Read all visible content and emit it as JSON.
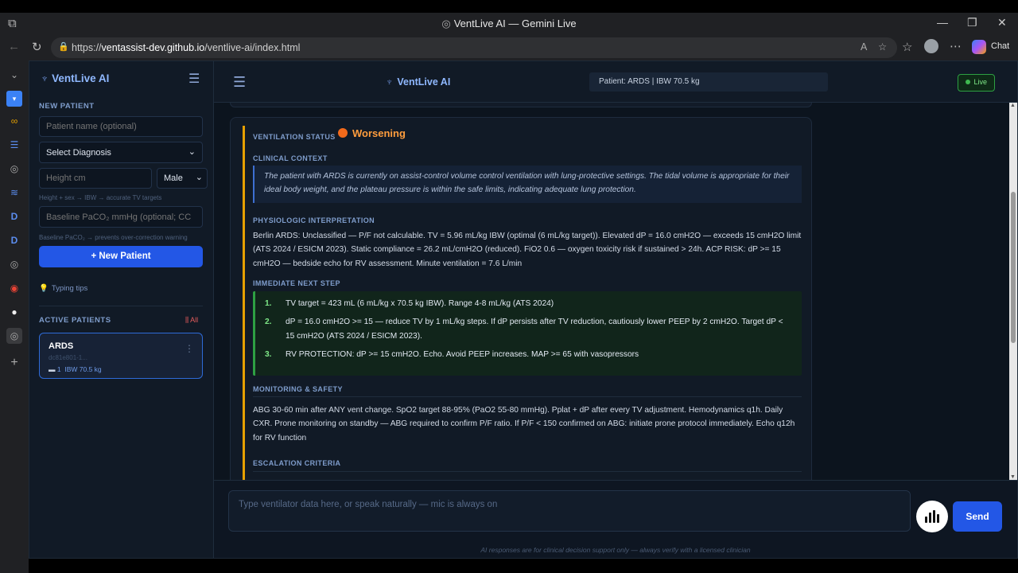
{
  "browser": {
    "window_title": "VentLive AI — Gemini Live",
    "url_prefix": "https://",
    "url_host": "ventassist-dev.github.io",
    "url_path": "/ventlive-ai/index.html",
    "chat_label": "Chat"
  },
  "sidebar": {
    "brand": "VentLive AI",
    "new_patient_label": "NEW PATIENT",
    "name_placeholder": "Patient name (optional)",
    "diagnosis_value": "Select Diagnosis",
    "height_placeholder": "Height cm",
    "sex_value": "Male",
    "height_hint": "Height + sex → IBW → accurate TV targets",
    "baseline_placeholder": "Baseline PaCO₂ mmHg (optional; CC",
    "baseline_hint": "Baseline PaCO₂ → prevents over-correction warning",
    "new_patient_button": "+ New Patient",
    "typing_tips": "Typing tips",
    "active_patients_label": "ACTIVE PATIENTS",
    "clear_all": "All",
    "patient": {
      "name": "ARDS",
      "id": "dc81e801-1...",
      "count": "1",
      "ibw": "IBW 70.5 kg"
    }
  },
  "header": {
    "brand": "VentLive AI",
    "patient_info": "Patient: ARDS | IBW 70.5 kg",
    "live": "Live"
  },
  "report": {
    "status_label": "VENTILATION STATUS",
    "status_value": "Worsening",
    "context_label": "CLINICAL CONTEXT",
    "context_text": "The patient with ARDS is currently on assist-control volume control ventilation with lung-protective settings. The tidal volume is appropriate for their ideal body weight, and the plateau pressure is within the safe limits, indicating adequate lung protection.",
    "physio_label": "PHYSIOLOGIC INTERPRETATION",
    "physio_text": "Berlin ARDS: Unclassified — P/F not calculable. TV = 5.96 mL/kg IBW (optimal (6 mL/kg target)). Elevated dP = 16.0 cmH2O — exceeds 15 cmH2O limit (ATS 2024 / ESICM 2023). Static compliance = 26.2 mL/cmH2O (reduced). FiO2 0.6 — oxygen toxicity risk if sustained > 24h. ACP RISK: dP >= 15 cmH2O — bedside echo for RV assessment. Minute ventilation = 7.6 L/min",
    "next_label": "IMMEDIATE NEXT STEP",
    "steps": [
      {
        "num": "1.",
        "text": "TV target = 423 mL (6 mL/kg x 70.5 kg IBW). Range 4-8 mL/kg (ATS 2024)"
      },
      {
        "num": "2.",
        "text": "dP = 16.0 cmH2O >= 15 — reduce TV by 1 mL/kg steps. If dP persists after TV reduction, cautiously lower PEEP by 2 cmH2O. Target dP < 15 cmH2O (ATS 2024 / ESICM 2023)."
      },
      {
        "num": "3.",
        "text": "RV PROTECTION: dP >= 15 cmH2O. Echo. Avoid PEEP increases. MAP >= 65 with vasopressors"
      }
    ],
    "monitor_label": "MONITORING & SAFETY",
    "monitor_text": "ABG 30-60 min after ANY vent change. SpO2 target 88-95% (PaO2 55-80 mmHg). Pplat + dP after every TV adjustment. Hemodynamics q1h. Daily CXR. Prone monitoring on standby — ABG required to confirm P/F ratio. If P/F < 150 confirmed on ABG: initiate prone protocol immediately. Echo q12h for RV function",
    "escalation_label": "ESCALATION CRITERIA"
  },
  "composer": {
    "placeholder": "Type ventilator data here, or speak naturally — mic is always on",
    "send": "Send",
    "disclaimer": "AI responses are for clinical decision support only — always verify with a licensed clinician"
  },
  "colors": {
    "accent": "#2357e6",
    "status_worsening": "#ff9d3d",
    "steps_green": "#2ea043",
    "card_bar": "#e6a000"
  }
}
